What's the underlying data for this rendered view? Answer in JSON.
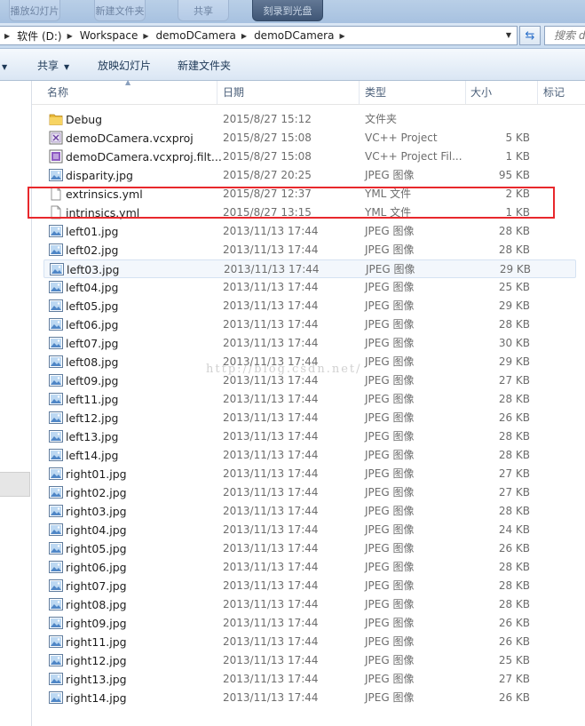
{
  "top_tabs": [
    {
      "label": "播放幻灯片"
    },
    {
      "label": "新建文件夹"
    },
    {
      "label": "共享"
    },
    {
      "label": "刻录到光盘"
    }
  ],
  "address": {
    "crumbs": [
      "软件 (D:)",
      "Workspace",
      "demoDCamera",
      "demoDCamera"
    ],
    "search_placeholder": "搜索 d"
  },
  "toolbar": {
    "share_label": "共享",
    "slideshow_label": "放映幻灯片",
    "new_folder_label": "新建文件夹"
  },
  "columns": {
    "name": "名称",
    "date": "日期",
    "type": "类型",
    "size": "大小",
    "tags": "标记"
  },
  "files": [
    {
      "name": "Debug",
      "date": "2015/8/27 15:12",
      "type": "文件夹",
      "size": "",
      "icon": "folder-icon"
    },
    {
      "name": "demoDCamera.vcxproj",
      "date": "2015/8/27 15:08",
      "type": "VC++ Project",
      "size": "5 KB",
      "icon": "vcxproj-icon"
    },
    {
      "name": "demoDCamera.vcxproj.filt...",
      "date": "2015/8/27 15:08",
      "type": "VC++ Project Fil...",
      "size": "1 KB",
      "icon": "vcxproj-filters-icon"
    },
    {
      "name": "disparity.jpg",
      "date": "2015/8/27 20:25",
      "type": "JPEG 图像",
      "size": "95 KB",
      "icon": "jpeg-icon"
    },
    {
      "name": "extrinsics.yml",
      "date": "2015/8/27 12:37",
      "type": "YML 文件",
      "size": "2 KB",
      "icon": "document-icon"
    },
    {
      "name": "intrinsics.yml",
      "date": "2015/8/27 13:15",
      "type": "YML 文件",
      "size": "1 KB",
      "icon": "document-icon"
    },
    {
      "name": "left01.jpg",
      "date": "2013/11/13 17:44",
      "type": "JPEG 图像",
      "size": "28 KB",
      "icon": "jpeg-icon"
    },
    {
      "name": "left02.jpg",
      "date": "2013/11/13 17:44",
      "type": "JPEG 图像",
      "size": "28 KB",
      "icon": "jpeg-icon"
    },
    {
      "name": "left03.jpg",
      "date": "2013/11/13 17:44",
      "type": "JPEG 图像",
      "size": "29 KB",
      "icon": "jpeg-icon"
    },
    {
      "name": "left04.jpg",
      "date": "2013/11/13 17:44",
      "type": "JPEG 图像",
      "size": "25 KB",
      "icon": "jpeg-icon"
    },
    {
      "name": "left05.jpg",
      "date": "2013/11/13 17:44",
      "type": "JPEG 图像",
      "size": "29 KB",
      "icon": "jpeg-icon"
    },
    {
      "name": "left06.jpg",
      "date": "2013/11/13 17:44",
      "type": "JPEG 图像",
      "size": "28 KB",
      "icon": "jpeg-icon"
    },
    {
      "name": "left07.jpg",
      "date": "2013/11/13 17:44",
      "type": "JPEG 图像",
      "size": "30 KB",
      "icon": "jpeg-icon"
    },
    {
      "name": "left08.jpg",
      "date": "2013/11/13 17:44",
      "type": "JPEG 图像",
      "size": "29 KB",
      "icon": "jpeg-icon"
    },
    {
      "name": "left09.jpg",
      "date": "2013/11/13 17:44",
      "type": "JPEG 图像",
      "size": "27 KB",
      "icon": "jpeg-icon"
    },
    {
      "name": "left11.jpg",
      "date": "2013/11/13 17:44",
      "type": "JPEG 图像",
      "size": "28 KB",
      "icon": "jpeg-icon"
    },
    {
      "name": "left12.jpg",
      "date": "2013/11/13 17:44",
      "type": "JPEG 图像",
      "size": "26 KB",
      "icon": "jpeg-icon"
    },
    {
      "name": "left13.jpg",
      "date": "2013/11/13 17:44",
      "type": "JPEG 图像",
      "size": "28 KB",
      "icon": "jpeg-icon"
    },
    {
      "name": "left14.jpg",
      "date": "2013/11/13 17:44",
      "type": "JPEG 图像",
      "size": "28 KB",
      "icon": "jpeg-icon"
    },
    {
      "name": "right01.jpg",
      "date": "2013/11/13 17:44",
      "type": "JPEG 图像",
      "size": "27 KB",
      "icon": "jpeg-icon"
    },
    {
      "name": "right02.jpg",
      "date": "2013/11/13 17:44",
      "type": "JPEG 图像",
      "size": "27 KB",
      "icon": "jpeg-icon"
    },
    {
      "name": "right03.jpg",
      "date": "2013/11/13 17:44",
      "type": "JPEG 图像",
      "size": "28 KB",
      "icon": "jpeg-icon"
    },
    {
      "name": "right04.jpg",
      "date": "2013/11/13 17:44",
      "type": "JPEG 图像",
      "size": "24 KB",
      "icon": "jpeg-icon"
    },
    {
      "name": "right05.jpg",
      "date": "2013/11/13 17:44",
      "type": "JPEG 图像",
      "size": "26 KB",
      "icon": "jpeg-icon"
    },
    {
      "name": "right06.jpg",
      "date": "2013/11/13 17:44",
      "type": "JPEG 图像",
      "size": "28 KB",
      "icon": "jpeg-icon"
    },
    {
      "name": "right07.jpg",
      "date": "2013/11/13 17:44",
      "type": "JPEG 图像",
      "size": "28 KB",
      "icon": "jpeg-icon"
    },
    {
      "name": "right08.jpg",
      "date": "2013/11/13 17:44",
      "type": "JPEG 图像",
      "size": "28 KB",
      "icon": "jpeg-icon"
    },
    {
      "name": "right09.jpg",
      "date": "2013/11/13 17:44",
      "type": "JPEG 图像",
      "size": "26 KB",
      "icon": "jpeg-icon"
    },
    {
      "name": "right11.jpg",
      "date": "2013/11/13 17:44",
      "type": "JPEG 图像",
      "size": "26 KB",
      "icon": "jpeg-icon"
    },
    {
      "name": "right12.jpg",
      "date": "2013/11/13 17:44",
      "type": "JPEG 图像",
      "size": "25 KB",
      "icon": "jpeg-icon"
    },
    {
      "name": "right13.jpg",
      "date": "2013/11/13 17:44",
      "type": "JPEG 图像",
      "size": "27 KB",
      "icon": "jpeg-icon"
    },
    {
      "name": "right14.jpg",
      "date": "2013/11/13 17:44",
      "type": "JPEG 图像",
      "size": "26 KB",
      "icon": "jpeg-icon"
    }
  ],
  "selected_file": "left03.jpg",
  "highlighted_files": [
    "extrinsics.yml",
    "intrinsics.yml"
  ],
  "watermark": "http://blog.csdn.net/",
  "colors": {
    "highlight_box": "#e8282c",
    "toolbar_text": "#1e3957",
    "header_text": "#4c607a"
  }
}
